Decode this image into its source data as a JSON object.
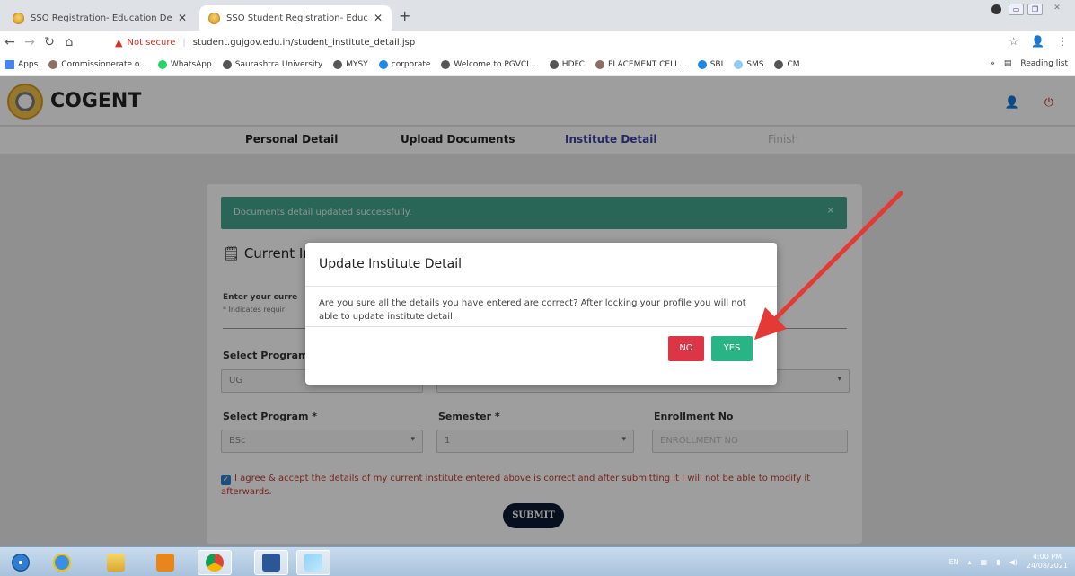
{
  "browser": {
    "tabs": [
      {
        "title": "SSO Registration- Education Dep",
        "active": false
      },
      {
        "title": "SSO Student Registration- Educa",
        "active": true
      }
    ],
    "new_tab": "+",
    "address": {
      "security_label": "Not secure",
      "url": "student.gujgov.edu.in/student_institute_detail.jsp"
    },
    "bookmarks": [
      {
        "label": "Apps",
        "color": "#4285f4"
      },
      {
        "label": "Commissionerate o...",
        "color": "#8d6e63"
      },
      {
        "label": "WhatsApp",
        "color": "#25d366"
      },
      {
        "label": "Saurashtra University",
        "color": "#555555"
      },
      {
        "label": "MYSY",
        "color": "#555555"
      },
      {
        "label": "corporate",
        "color": "#1e88e5"
      },
      {
        "label": "Welcome to PGVCL...",
        "color": "#555555"
      },
      {
        "label": "HDFC",
        "color": "#555555"
      },
      {
        "label": "PLACEMENT CELL...",
        "color": "#8d6e63"
      },
      {
        "label": "SBI",
        "color": "#1e88e5"
      },
      {
        "label": "SMS",
        "color": "#90caf9"
      },
      {
        "label": "CM",
        "color": "#555555"
      }
    ],
    "bookmarks_overflow": "»",
    "reading_list": "Reading list"
  },
  "app": {
    "brand": "COGENT",
    "steps": [
      {
        "label": "Personal Detail",
        "state": "done"
      },
      {
        "label": "Upload Documents",
        "state": "done"
      },
      {
        "label": "Institute Detail",
        "state": "active"
      },
      {
        "label": "Finish",
        "state": "pending"
      }
    ]
  },
  "form": {
    "alert": "Documents detail updated successfully.",
    "alert_close": "×",
    "section_title": "Current In",
    "hint": "Enter your curre",
    "required_note": "* Indicates requir",
    "select_program_type_label": "Select Program",
    "select_program_type_value": "UG",
    "select_program_label": "Select Program *",
    "select_program_value": "BSc",
    "semester_label": "Semester *",
    "semester_value": "1",
    "enrollment_label": "Enrollment No",
    "enrollment_placeholder": "ENROLLMENT NO",
    "agree_text": "I agree & accept the details of my current institute entered above is correct and after submitting it I will not be able to modify it afterwards.",
    "submit_label": "SUBMIT"
  },
  "modal": {
    "title": "Update Institute Detail",
    "body": "Are you sure all the details you have entered are correct? After locking your profile you will not able to update institute detail.",
    "no_label": "NO",
    "yes_label": "YES",
    "annotation_arrow_color": "#e53935"
  },
  "taskbar": {
    "language": "EN",
    "time": "4:00 PM",
    "date": "24/08/2021"
  },
  "colors": {
    "alert_bg": "#45a58f",
    "active_step": "#3b3f9e",
    "no_button": "#dc3545",
    "yes_button": "#28b485",
    "submit_button": "#0e1b33"
  }
}
